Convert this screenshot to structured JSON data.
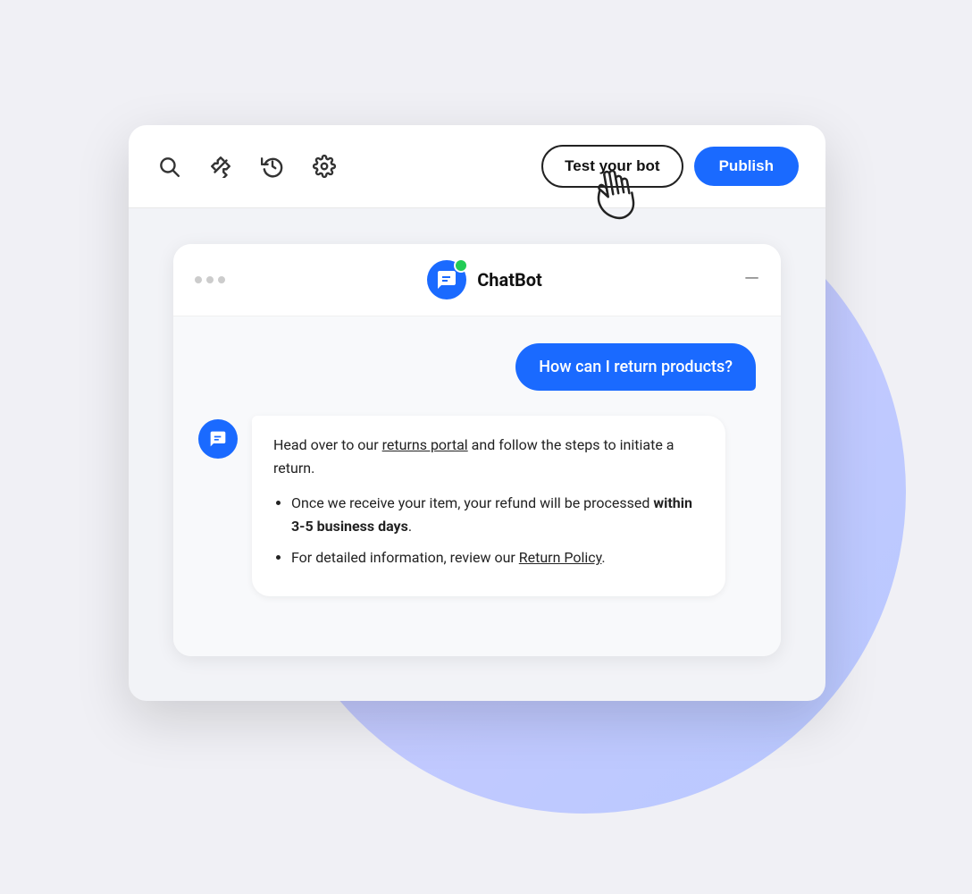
{
  "scene": {
    "bg_circle_visible": true
  },
  "toolbar": {
    "icons": [
      {
        "name": "search",
        "symbol": "🔍"
      },
      {
        "name": "plugin",
        "symbol": "⚡"
      },
      {
        "name": "history",
        "symbol": "🕐"
      },
      {
        "name": "settings",
        "symbol": "⚙️"
      }
    ],
    "test_bot_label": "Test your bot",
    "publish_label": "Publish"
  },
  "chat": {
    "header": {
      "bot_name": "ChatBot",
      "minimize_symbol": "—"
    },
    "user_message": "How can I return products?",
    "bot_response": {
      "intro": "Head over to our returns portal and follow the steps to initiate a return.",
      "returns_portal_link": "returns portal",
      "bullet1": "Once we receive your item, your refund will be processed within 3-5 business days.",
      "bullet2": "For detailed information, review our Return Policy.",
      "return_policy_link": "Return Policy"
    }
  },
  "colors": {
    "primary_blue": "#1a6aff",
    "bg_circle": "#c8cef5",
    "toolbar_bg": "#ffffff",
    "chat_bg": "#f8f9fb",
    "bubble_blue": "#1a6aff",
    "bubble_white": "#ffffff"
  }
}
